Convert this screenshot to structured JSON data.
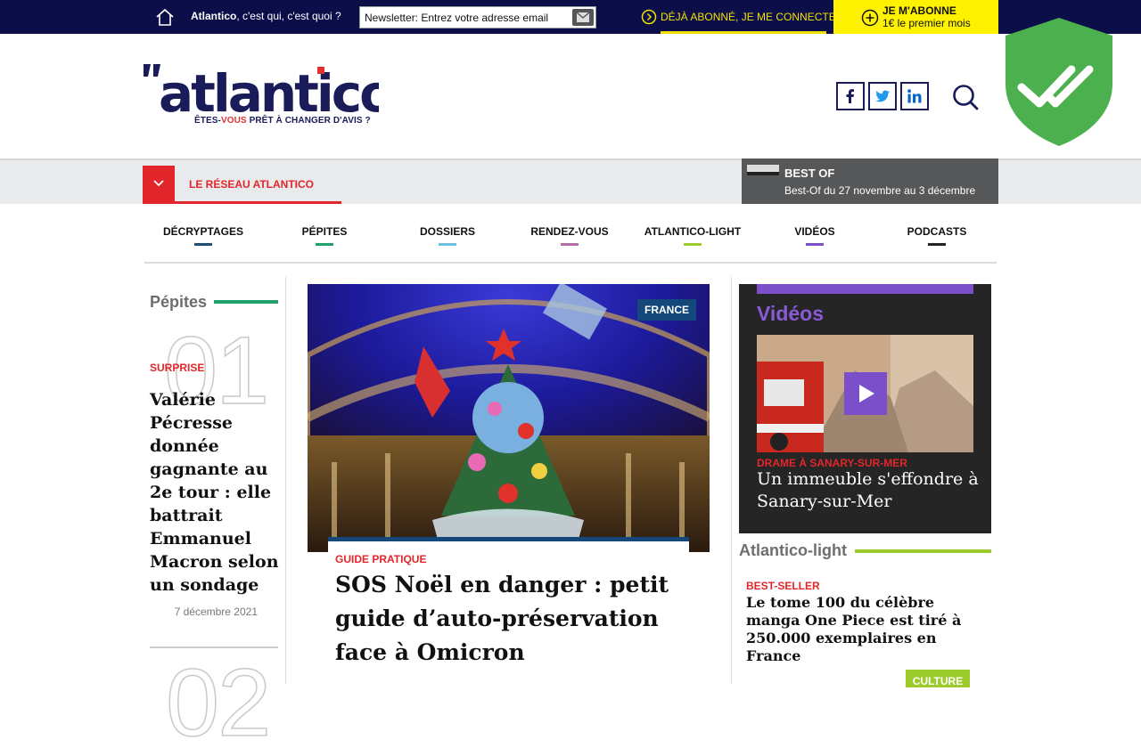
{
  "topbar": {
    "about_brand": "Atlantico",
    "about_rest": ", c'est qui, c'est quoi ?",
    "newsletter_placeholder": "Newsletter: Entrez votre adresse email",
    "login_label": "DÉJÀ ABONNÉ, JE ME CONNECTE",
    "subscribe_line1": "JE M'ABONNE",
    "subscribe_line2": "1€ le premier mois"
  },
  "header": {
    "logo_text": "atlantico",
    "tagline_pre": "ÊTES-",
    "tagline_accent": "VOUS",
    "tagline_post": " PRÊT À CHANGER D'AVIS ?"
  },
  "network": {
    "label": "LE RÉSEAU ATLANTICO",
    "bestof_title": "BEST OF",
    "bestof_sub": "Best-Of du 27 novembre au 3 décembre"
  },
  "nav": [
    {
      "label": "DÉCRYPTAGES",
      "color": "#1b4f7a"
    },
    {
      "label": "PÉPITES",
      "color": "#22a06b"
    },
    {
      "label": "DOSSIERS",
      "color": "#6cc0e0"
    },
    {
      "label": "RENDEZ-VOUS",
      "color": "#b76ca6"
    },
    {
      "label": "ATLANTICO-LIGHT",
      "color": "#9ccc2c"
    },
    {
      "label": "VIDÉOS",
      "color": "#7b4fc9"
    },
    {
      "label": "PODCASTS",
      "color": "#222222"
    }
  ],
  "pepites": {
    "title": "Pépites",
    "number": "01",
    "kicker": "SURPRISE",
    "headline": "Valérie Pécresse donnée gagnante au 2e tour : elle battrait Emmanuel Macron selon un sondage",
    "date": "7 décembre 2021",
    "number2": "02"
  },
  "hero": {
    "tag": "FRANCE",
    "kicker": "GUIDE PRATIQUE",
    "headline": "SOS Noël en danger : petit guide d’auto-préservation face à Omicron"
  },
  "videos": {
    "title": "Vidéos",
    "kicker": "DRAME À SANARY-SUR-MER",
    "headline": "Un immeuble s'effondre à Sanary-sur-Mer"
  },
  "light": {
    "title": "Atlantico-light",
    "kicker": "BEST-SELLER",
    "headline": "Le tome 100 du célèbre manga One Piece est tiré à 250.000 exemplaires en France",
    "next_tag": "CULTURE"
  }
}
